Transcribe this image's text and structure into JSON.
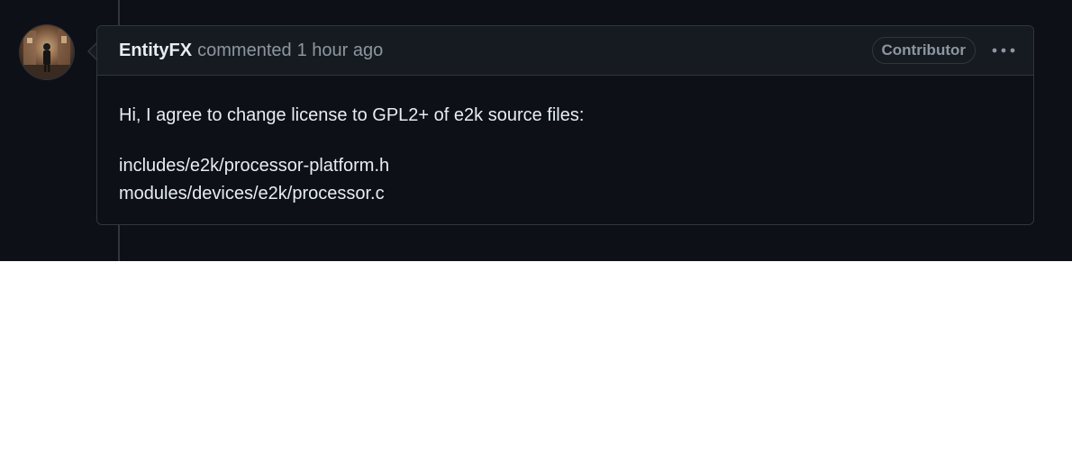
{
  "comment": {
    "author": "EntityFX",
    "action": "commented",
    "timestamp": "1 hour ago",
    "badge": "Contributor",
    "more_icon": "kebab-horizontal-icon",
    "body": {
      "intro": "Hi, I agree to change license to GPL2+ of e2k source files:",
      "files": [
        "includes/e2k/processor-platform.h",
        "modules/devices/e2k/processor.c"
      ]
    }
  },
  "colors": {
    "background": "#0d1117",
    "header_background": "#161b22",
    "border": "#30363d",
    "text_primary": "#e6edf3",
    "text_muted": "#8d96a0"
  }
}
